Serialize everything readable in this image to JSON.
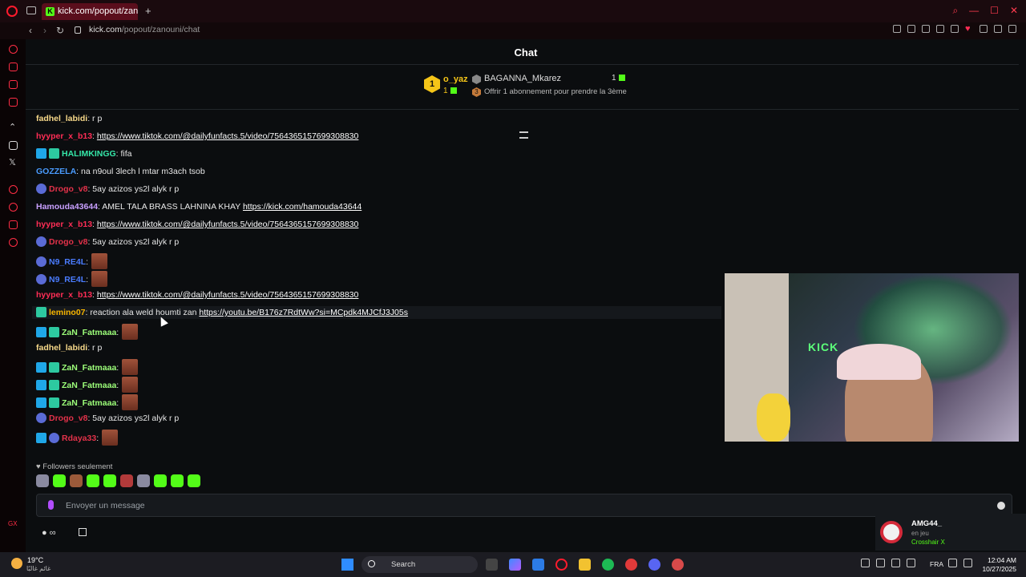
{
  "browser": {
    "tab_title": "kick.com/popout/zanouni",
    "tab_favicon": "K",
    "new_tab_symbol": "+",
    "url_host": "kick.com",
    "url_path": "/popout/zanouni/chat",
    "accent_color": "#ff1b2d"
  },
  "chat": {
    "title": "Chat",
    "leaderboard": {
      "first_rank": "1",
      "first_name": "o_yaz",
      "first_count": "1",
      "second_name": "BAGANNA_Mkarez",
      "second_count": "1",
      "third_rank": "3",
      "third_text": "Offrir 1 abonnement pour prendre la 3ème"
    },
    "messages": [
      {
        "badges": [],
        "user": "fadhel_labidi",
        "color": "#f7d98a",
        "sep": ":",
        "text": " r p",
        "link": "",
        "emotes": 0
      },
      {
        "badges": [],
        "user": "hyyper_x_b13",
        "color": "#ff2d55",
        "sep": ":",
        "text": " ",
        "link": "https://www.tiktok.com/@dailyfunfacts.5/video/7564365157699308830",
        "emotes": 0
      },
      {
        "badges": [
          "verified",
          "sub"
        ],
        "user": "HALIMKINGG",
        "color": "#35e6a8",
        "sep": ":",
        "text": " fifa",
        "link": "",
        "emotes": 0
      },
      {
        "badges": [],
        "user": "GOZZELA",
        "color": "#4a9cff",
        "sep": ":",
        "text": " na n9oul 3lech l mtar m3ach tsob",
        "link": "",
        "emotes": 0
      },
      {
        "badges": [
          "og"
        ],
        "user": "Drogo_v8",
        "color": "#e3324a",
        "sep": ":",
        "text": " 5ay azizos ys2l alyk r p",
        "link": "",
        "emotes": 0
      },
      {
        "badges": [],
        "user": "Hamouda43644",
        "color": "#c8a0ff",
        "sep": ":",
        "text": " AMEL TALA BRASS LAHNINA KHAY ",
        "link": "https://kick.com/hamouda43644",
        "emotes": 0
      },
      {
        "badges": [],
        "user": "hyyper_x_b13",
        "color": "#ff2d55",
        "sep": ":",
        "text": " ",
        "link": "https://www.tiktok.com/@dailyfunfacts.5/video/7564365157699308830",
        "emotes": 0
      },
      {
        "badges": [
          "og"
        ],
        "user": "Drogo_v8",
        "color": "#e3324a",
        "sep": ":",
        "text": " 5ay azizos ys2l alyk r p",
        "link": "",
        "emotes": 0
      },
      {
        "badges": [
          "og"
        ],
        "user": "N9_RE4L",
        "color": "#4a7cff",
        "sep": ":",
        "text": " ",
        "link": "",
        "emotes": 1
      },
      {
        "badges": [
          "og"
        ],
        "user": "N9_RE4L",
        "color": "#4a7cff",
        "sep": ":",
        "text": " ",
        "link": "",
        "emotes": 1
      },
      {
        "badges": [],
        "user": "hyyper_x_b13",
        "color": "#ff2d55",
        "sep": ":",
        "text": " ",
        "link": "https://www.tiktok.com/@dailyfunfacts.5/video/7564365157699308830",
        "emotes": 0
      },
      {
        "badges": [
          "sub"
        ],
        "user": "lemino07",
        "color": "#f7b500",
        "sep": ":",
        "text": " reaction ala weld houmti zan ",
        "link": "https://youtu.be/B176z7RdtWw?si=MCpdk4MJCfJ3J05s",
        "emotes": 0
      },
      {
        "badges": [
          "verified",
          "sub"
        ],
        "user": "ZaN_Fatmaaa",
        "color": "#9dff7a",
        "sep": ":",
        "text": " ",
        "link": "",
        "emotes": 1
      },
      {
        "badges": [],
        "user": "fadhel_labidi",
        "color": "#f7d98a",
        "sep": ":",
        "text": " r p",
        "link": "",
        "emotes": 0
      },
      {
        "badges": [
          "verified",
          "sub"
        ],
        "user": "ZaN_Fatmaaa",
        "color": "#9dff7a",
        "sep": ":",
        "text": " ",
        "link": "",
        "emotes": 1
      },
      {
        "badges": [
          "verified",
          "sub"
        ],
        "user": "ZaN_Fatmaaa",
        "color": "#9dff7a",
        "sep": ":",
        "text": " ",
        "link": "",
        "emotes": 1
      },
      {
        "badges": [
          "verified",
          "sub"
        ],
        "user": "ZaN_Fatmaaa",
        "color": "#9dff7a",
        "sep": ":",
        "text": " ",
        "link": "",
        "emotes": 1
      },
      {
        "badges": [
          "og"
        ],
        "user": "Drogo_v8",
        "color": "#e3324a",
        "sep": ":",
        "text": " 5ay azizos ys2l alyk r p",
        "link": "",
        "emotes": 0
      },
      {
        "badges": [
          "verified",
          "og"
        ],
        "user": "Rdaya33",
        "color": "#e3324a",
        "sep": ":",
        "text": " ",
        "link": "",
        "emotes": 1
      }
    ],
    "highlighted_index": 11,
    "followers_only": "Followers seulement",
    "input_placeholder": "Envoyer un message",
    "emote_bar": [
      "grey",
      "green",
      "brown",
      "green",
      "green",
      "red",
      "grey",
      "green",
      "green",
      "green"
    ],
    "bottom_infinity": "∞"
  },
  "stream": {
    "overlay_text": "KICK"
  },
  "notification": {
    "name": "AMG44_",
    "status": "en jeu",
    "game": "Crosshair X"
  },
  "taskbar": {
    "temperature": "19°C",
    "weather_desc": "غائم غالبًا",
    "search_label": "Search",
    "language": "FRA",
    "time": "12:04 AM",
    "date": "10/27/2025"
  }
}
